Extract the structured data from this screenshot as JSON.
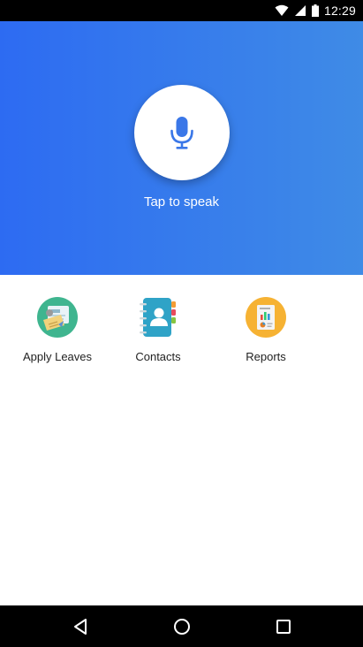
{
  "status_bar": {
    "time": "12:29"
  },
  "hero": {
    "prompt": "Tap to speak",
    "colors": {
      "gradient_start": "#2d6bf2",
      "gradient_end": "#3f8be6",
      "mic_icon": "#3a77e8"
    }
  },
  "tiles": [
    {
      "label": "Apply Leaves",
      "icon": "leave-application-icon"
    },
    {
      "label": "Contacts",
      "icon": "address-book-icon"
    },
    {
      "label": "Reports",
      "icon": "report-chart-icon"
    }
  ],
  "nav": {
    "back_icon": "back-triangle-icon",
    "home_icon": "home-circle-icon",
    "recents_icon": "recents-square-icon"
  }
}
